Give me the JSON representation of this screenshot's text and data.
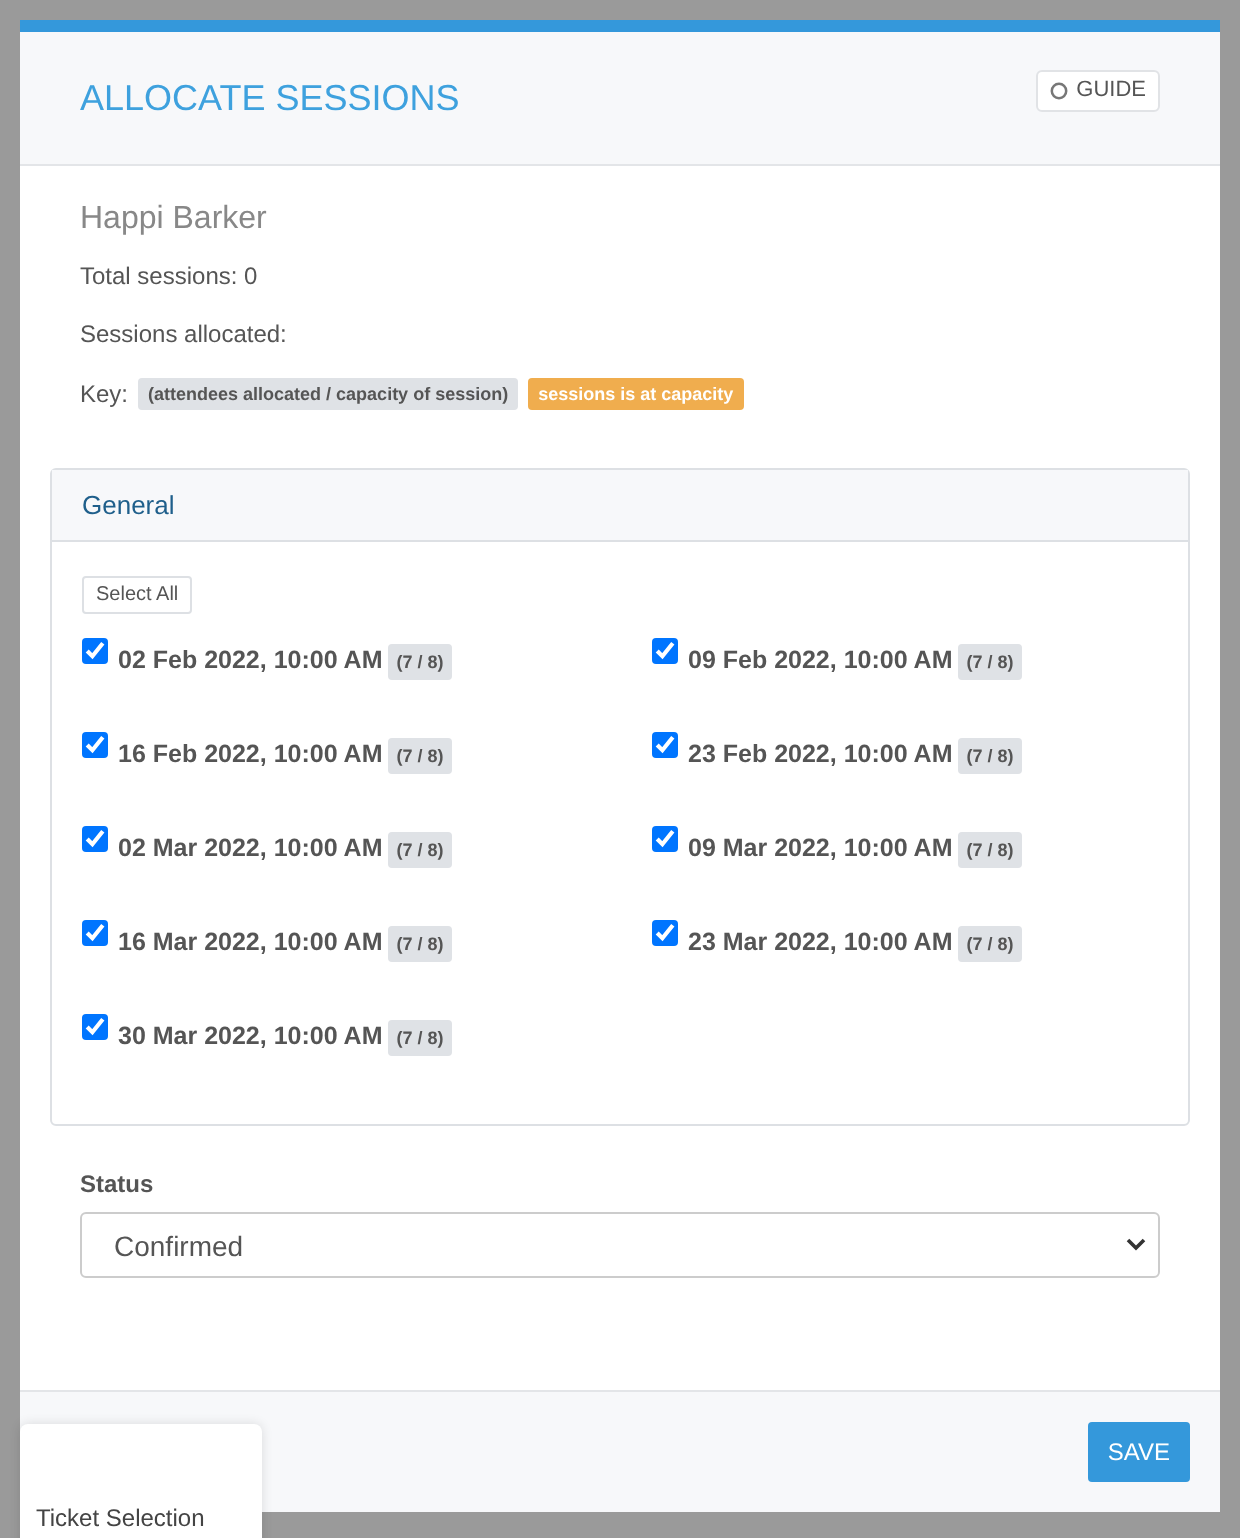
{
  "background": {
    "card": {
      "title": "Ticket Selection"
    }
  },
  "modal": {
    "title": "ALLOCATE SESSIONS",
    "guide_button": "GUIDE",
    "attendee": "Happi Barker",
    "total_sessions": "Total sessions: 0",
    "sessions_allocated": "Sessions allocated:",
    "key": {
      "label": "Key:",
      "badges": [
        {
          "text": "(attendees allocated / capacity of session)",
          "kind": "neutral"
        },
        {
          "text": "sessions is at capacity",
          "kind": "warning"
        }
      ]
    },
    "group": {
      "title": "General",
      "select_all": "Select All",
      "sessions": [
        {
          "date": "02 Feb 2022, 10:00 AM",
          "count": "(7 / 8)",
          "checked": true
        },
        {
          "date": "09 Feb 2022, 10:00 AM",
          "count": "(7 / 8)",
          "checked": true
        },
        {
          "date": "16 Feb 2022, 10:00 AM",
          "count": "(7 / 8)",
          "checked": true
        },
        {
          "date": "23 Feb 2022, 10:00 AM",
          "count": "(7 / 8)",
          "checked": true
        },
        {
          "date": "02 Mar 2022, 10:00 AM",
          "count": "(7 / 8)",
          "checked": true
        },
        {
          "date": "09 Mar 2022, 10:00 AM",
          "count": "(7 / 8)",
          "checked": true
        },
        {
          "date": "16 Mar 2022, 10:00 AM",
          "count": "(7 / 8)",
          "checked": true
        },
        {
          "date": "23 Mar 2022, 10:00 AM",
          "count": "(7 / 8)",
          "checked": true
        },
        {
          "date": "30 Mar 2022, 10:00 AM",
          "count": "(7 / 8)",
          "checked": true
        }
      ]
    },
    "status": {
      "label": "Status",
      "value": "Confirmed"
    },
    "save_button": "SAVE"
  }
}
